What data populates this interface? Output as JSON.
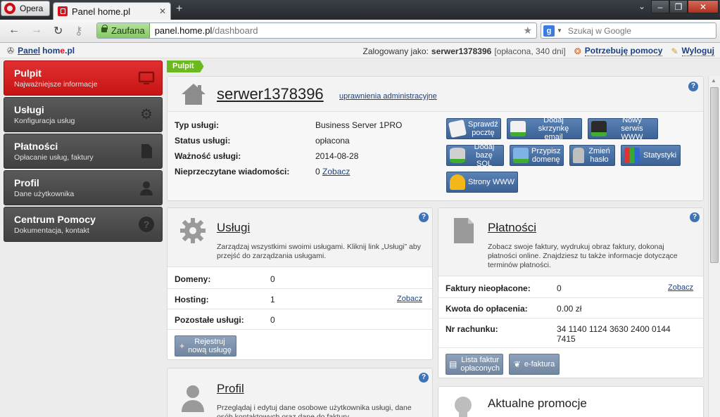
{
  "browser": {
    "menu_label": "Opera",
    "tab_title": "Panel home.pl",
    "trusted_label": "Zaufana",
    "url_host": "panel.home.pl",
    "url_path": "/dashboard",
    "search_placeholder": "Szukaj w Google"
  },
  "header": {
    "logo_panel": "Panel",
    "logo_home_a": "hom",
    "logo_home_e": "e",
    "logo_home_b": ".pl",
    "logged_as_label": "Zalogowany jako:",
    "username": "serwer1378396",
    "account_status": "[opłacona, 340 dni]",
    "help_link": "Potrzebuję pomocy",
    "logout_link": "Wyloguj"
  },
  "sidebar": {
    "items": [
      {
        "title": "Pulpit",
        "subtitle": "Najważniejsze informacje",
        "icon": "monitor-icon"
      },
      {
        "title": "Usługi",
        "subtitle": "Konfiguracja usług",
        "icon": "gear-icon"
      },
      {
        "title": "Płatności",
        "subtitle": "Opłacanie usług, faktury",
        "icon": "document-icon"
      },
      {
        "title": "Profil",
        "subtitle": "Dane użytkownika",
        "icon": "person-icon"
      },
      {
        "title": "Centrum Pomocy",
        "subtitle": "Dokumentacja, kontakt",
        "icon": "question-icon"
      }
    ]
  },
  "breadcrumb": "Pulpit",
  "server": {
    "name": "serwer1378396",
    "admin_link": "uprawnienia administracyjne",
    "rows": [
      {
        "label": "Typ usługi:",
        "value": "Business Server 1PRO"
      },
      {
        "label": "Status usługi:",
        "value": "opłacona"
      },
      {
        "label": "Ważność usługi:",
        "value": "2014-08-28"
      },
      {
        "label": "Nieprzeczytane wiadomości:",
        "value": "0",
        "link": "Zobacz"
      }
    ],
    "actions": [
      {
        "label": "Sprawdź pocztę",
        "line1": "Sprawdź",
        "line2": "pocztę",
        "icon": "mail-icon"
      },
      {
        "label": "Dodaj skrzynkę email",
        "line1": "Dodaj",
        "line2": "skrzynkę email",
        "icon": "add-mailbox-icon"
      },
      {
        "label": "Nowy serwis WWW",
        "line1": "Nowy",
        "line2": "serwis WWW",
        "icon": "new-site-icon"
      },
      {
        "label": "Dodaj bazę SQL",
        "line1": "Dodaj",
        "line2": "bazę SQL",
        "icon": "database-icon"
      },
      {
        "label": "Przypisz domenę",
        "line1": "Przypisz",
        "line2": "domenę",
        "icon": "domain-icon"
      },
      {
        "label": "Zmień hasło",
        "line1": "Zmień",
        "line2": "hasło",
        "icon": "lock-icon"
      },
      {
        "label": "Statystyki",
        "line1": "Statystyki",
        "line2": "",
        "icon": "stats-icon"
      },
      {
        "label": "Strony WWW",
        "line1": "Strony WWW",
        "line2": "",
        "icon": "helmet-icon"
      }
    ]
  },
  "services": {
    "title": "Usługi",
    "description": "Zarządzaj wszystkimi swoimi usługami. Kliknij link „Usługi” aby przejść do zarządzania usługami.",
    "rows": [
      {
        "label": "Domeny:",
        "value": "0",
        "link": ""
      },
      {
        "label": "Hosting:",
        "value": "1",
        "link": "Zobacz"
      },
      {
        "label": "Pozostałe usługi:",
        "value": "0",
        "link": ""
      }
    ],
    "button_line1": "Rejestruj",
    "button_line2": "nową usługę"
  },
  "payments": {
    "title": "Płatności",
    "description": "Zobacz swoje faktury, wydrukuj obraz faktury, dokonaj płatności online. Znajdziesz tu także informacje dotyczące terminów płatności.",
    "rows": [
      {
        "label": "Faktury nieopłacone:",
        "value": "0",
        "link": "Zobacz"
      },
      {
        "label": "Kwota do opłacenia:",
        "value": "0.00 zł",
        "link": ""
      },
      {
        "label": "Nr rachunku:",
        "value": "34 1140 1124 3630 2400 0144 7415",
        "link": ""
      }
    ],
    "button1_line1": "Lista faktur",
    "button1_line2": "opłaconych",
    "button2": "e-faktura"
  },
  "profile": {
    "title": "Profil",
    "description": "Przeglądaj i edytuj dane osobowe użytkownika usługi, dane osób kontaktowych oraz dane do faktury."
  },
  "promotions": {
    "title": "Aktualne promocje"
  },
  "colors": {
    "active_red": "#d21c1c",
    "action_blue": "#4a71a5",
    "crumb_green": "#6ab91f",
    "link_blue": "#1b3f80"
  }
}
